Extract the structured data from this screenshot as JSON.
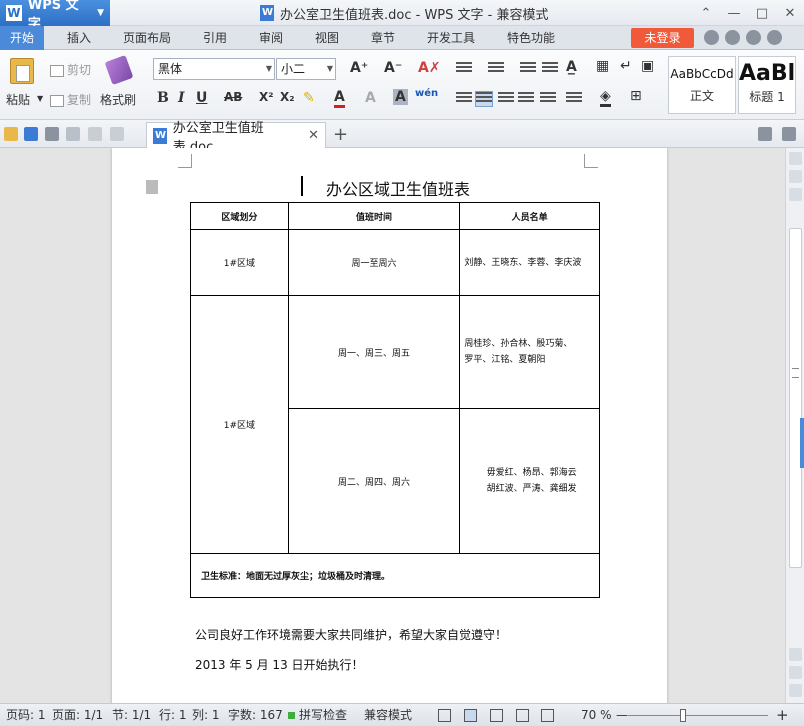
{
  "app": {
    "name": "WPS 文字",
    "window_title": "办公室卫生值班表.doc - WPS 文字 - 兼容模式"
  },
  "menu": {
    "tabs": [
      "开始",
      "插入",
      "页面布局",
      "引用",
      "审阅",
      "视图",
      "章节",
      "开发工具",
      "特色功能"
    ],
    "login": "未登录"
  },
  "ribbon": {
    "paste": "粘贴",
    "cut": "剪切",
    "copy": "复制",
    "format_painter": "格式刷",
    "font_name": "黑体",
    "font_size": "小二",
    "styles": [
      {
        "preview": "AaBbCcDd",
        "name": "正文"
      },
      {
        "preview": "AaBl",
        "name": "标题 1"
      }
    ]
  },
  "doc_tab": {
    "name": "办公室卫生值班表.doc"
  },
  "document": {
    "title": "办公区域卫生值班表",
    "table": {
      "headers": [
        "区域划分",
        "值班时间",
        "人员名单"
      ],
      "rows": [
        {
          "area": "1#区域",
          "time": "周一至周六",
          "names": "刘静、王晓东、李蓉、李庆波"
        },
        {
          "area": "1#区域",
          "time": "周一、周三、周五",
          "names_l1": "周桂珍、孙合林、殷巧菊、",
          "names_l2": "罗平、江铭、夏朝阳"
        },
        {
          "time": "周二、周四、周六",
          "names_l1": "毋爱红、杨昂、郭海云",
          "names_l2": "胡红波、严涛、龚细发"
        }
      ],
      "standard": "卫生标准：地面无过厚灰尘；垃圾桶及时清理。"
    },
    "para1": "公司良好工作环境需要大家共同维护，希望大家自觉遵守！",
    "para2": "2013 年 5 月 13 日开始执行！"
  },
  "status": {
    "page_no": "页码: 1",
    "pages": "页面: 1/1",
    "section": "节: 1/1",
    "row": "行: 1",
    "col": "列: 1",
    "words": "字数: 167",
    "spell": "拼写检查",
    "compat": "兼容模式",
    "zoom": "70 %"
  }
}
